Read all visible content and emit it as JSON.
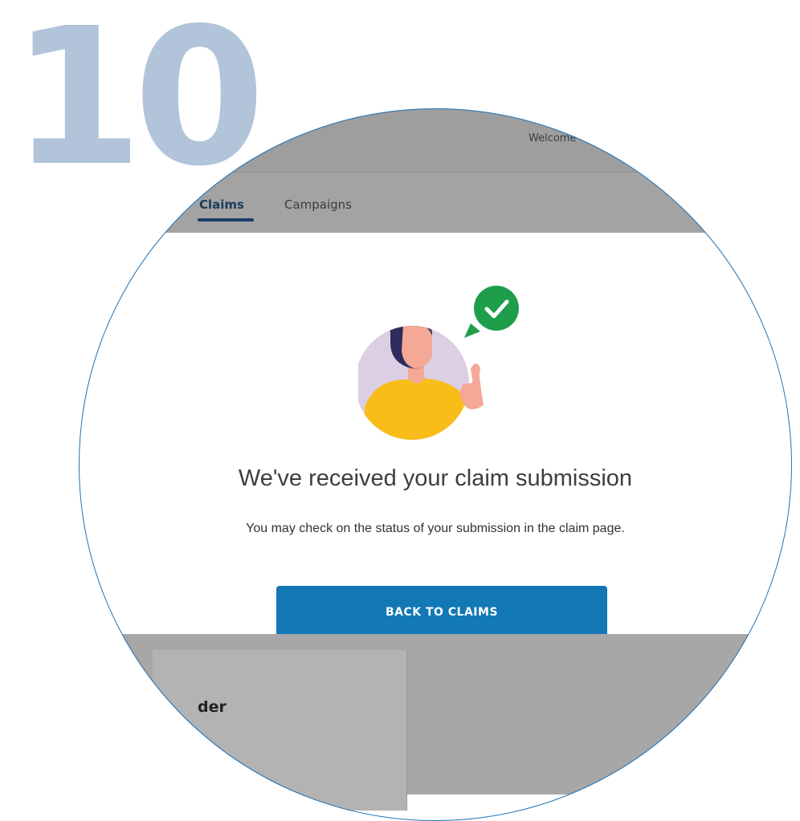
{
  "step": {
    "number": "10"
  },
  "header": {
    "welcome_text": "Welcome"
  },
  "nav": {
    "tabs": [
      {
        "label": "Claims",
        "active": true
      },
      {
        "label": "Campaigns",
        "active": false
      }
    ]
  },
  "modal": {
    "illustration": "woman-thumbs-up-checkmark",
    "title": "We've received your claim submission",
    "message": "You may check on the status of your submission in the claim page.",
    "button_label": "BACK TO CLAIMS"
  },
  "background_card": {
    "partial_text": "der"
  },
  "colors": {
    "accent": "#1278b6",
    "step_number": "#b1c4da",
    "success": "#1e9e4a",
    "lens_ring": "#1f73b6"
  }
}
